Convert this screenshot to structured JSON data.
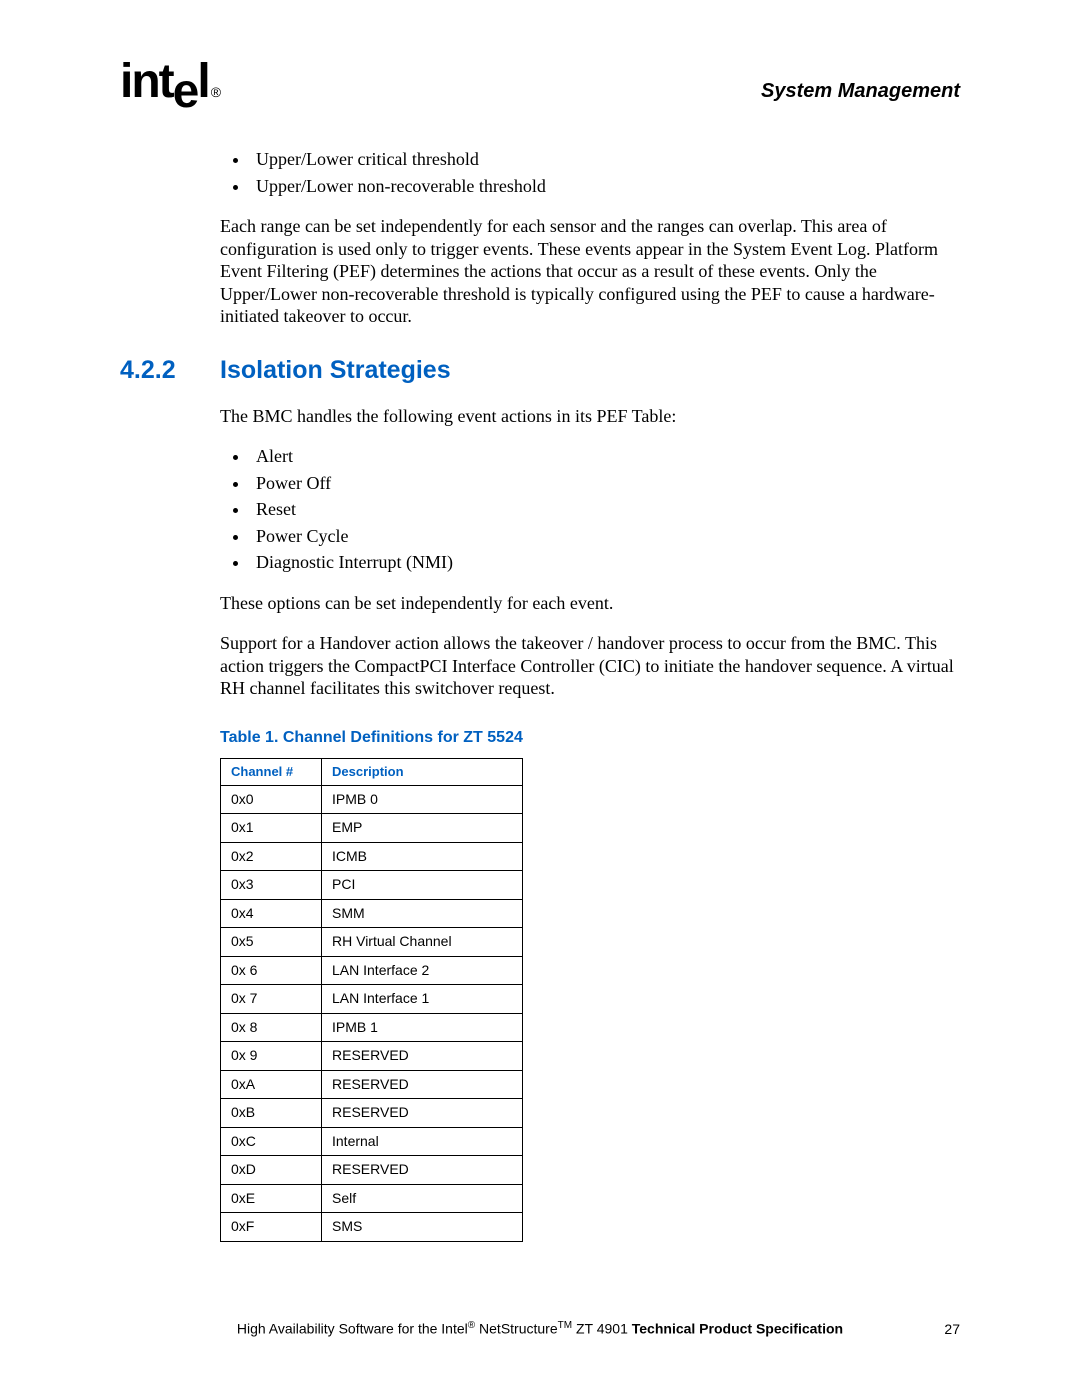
{
  "header": {
    "logo_text": "intel",
    "logo_reg": "®",
    "chapter": "System Management"
  },
  "thresholds": [
    "Upper/Lower critical threshold",
    "Upper/Lower non-recoverable threshold"
  ],
  "para_ranges": "Each range can be set independently for each sensor and the ranges can overlap. This area of configuration is used only to trigger events. These events appear in the System Event Log. Platform Event Filtering (PEF) determines the actions that occur as a result of these events. Only the Upper/Lower non-recoverable threshold is typically configured using the PEF to cause a hardware-initiated takeover to occur.",
  "section_422": {
    "num": "4.2.2",
    "title": "Isolation Strategies"
  },
  "para_bmc_handles": "The BMC handles the following event actions in its PEF Table:",
  "actions": [
    "Alert",
    "Power Off",
    "Reset",
    "Power Cycle",
    "Diagnostic Interrupt (NMI)"
  ],
  "para_options": "These options can be set independently for each event.",
  "para_handover": "Support for a Handover action allows the takeover / handover process to occur from the BMC. This action triggers the CompactPCI Interface Controller (CIC) to initiate the handover sequence. A virtual RH channel facilitates this switchover request.",
  "table": {
    "caption": "Table 1.   Channel Definitions for ZT 5524",
    "headers": {
      "ch": "Channel #",
      "desc": "Description"
    },
    "rows": [
      {
        "ch": "0x0",
        "desc": "IPMB 0"
      },
      {
        "ch": "0x1",
        "desc": "EMP"
      },
      {
        "ch": "0x2",
        "desc": "ICMB"
      },
      {
        "ch": "0x3",
        "desc": "PCI"
      },
      {
        "ch": "0x4",
        "desc": "SMM"
      },
      {
        "ch": "0x5",
        "desc": "RH Virtual Channel"
      },
      {
        "ch": "0x 6",
        "desc": "LAN Interface 2"
      },
      {
        "ch": "0x 7",
        "desc": "LAN Interface 1"
      },
      {
        "ch": "0x 8",
        "desc": "IPMB 1"
      },
      {
        "ch": "0x 9",
        "desc": "RESERVED"
      },
      {
        "ch": "0xA",
        "desc": "RESERVED"
      },
      {
        "ch": "0xB",
        "desc": "RESERVED"
      },
      {
        "ch": "0xC",
        "desc": "Internal"
      },
      {
        "ch": "0xD",
        "desc": "RESERVED"
      },
      {
        "ch": "0xE",
        "desc": "Self"
      },
      {
        "ch": "0xF",
        "desc": "SMS"
      }
    ]
  },
  "footer": {
    "prefix": "High Availability Software for the Intel",
    "reg": "®",
    "mid": " NetStructure",
    "tm": "TM",
    "suffix": " ZT 4901 ",
    "bold": "Technical Product Specification",
    "page": "27"
  }
}
